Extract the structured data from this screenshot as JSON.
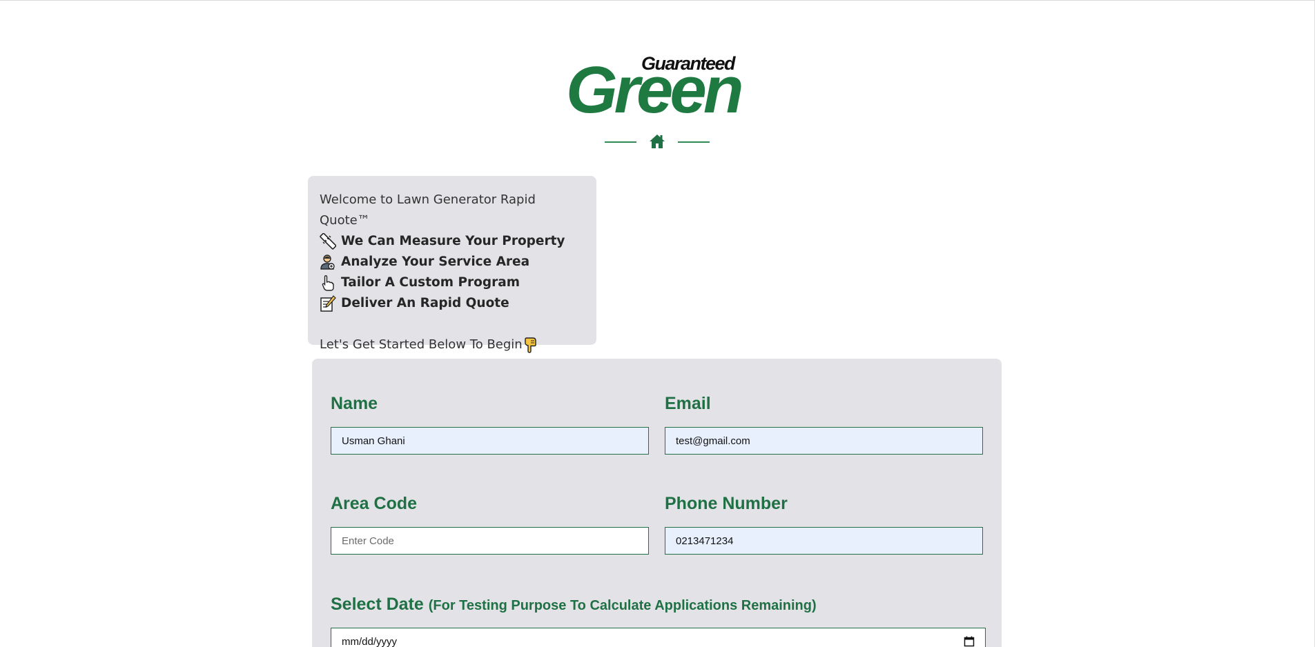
{
  "brand": {
    "logo_small": "Guaranteed",
    "logo_big": "Green"
  },
  "welcome": {
    "intro": "Welcome to Lawn Generator Rapid Quote™",
    "items": [
      {
        "icon": "ruler-icon",
        "label": "We Can Measure Your Property"
      },
      {
        "icon": "analyst-icon",
        "label": "Analyze Your Service Area"
      },
      {
        "icon": "pointing-hand-icon",
        "label": "Tailor A Custom Program"
      },
      {
        "icon": "memo-icon",
        "label": "Deliver An Rapid Quote"
      }
    ],
    "outro": "Let's Get Started Below To Begin"
  },
  "form": {
    "name": {
      "label": "Name",
      "value": "Usman Ghani"
    },
    "email": {
      "label": "Email",
      "value": "test@gmail.com"
    },
    "area_code": {
      "label": "Area Code",
      "value": "",
      "placeholder": "Enter Code"
    },
    "phone": {
      "label": "Phone Number",
      "value": "0213471234"
    },
    "date": {
      "label": "Select Date",
      "sublabel": "(For Testing Purpose To Calculate Applications Remaining)",
      "placeholder": "mm/dd/yyyy"
    }
  },
  "colors": {
    "brand_green": "#1f7044",
    "card_bg": "#e3e3e7",
    "autofill_bg": "#e8f0fe"
  }
}
